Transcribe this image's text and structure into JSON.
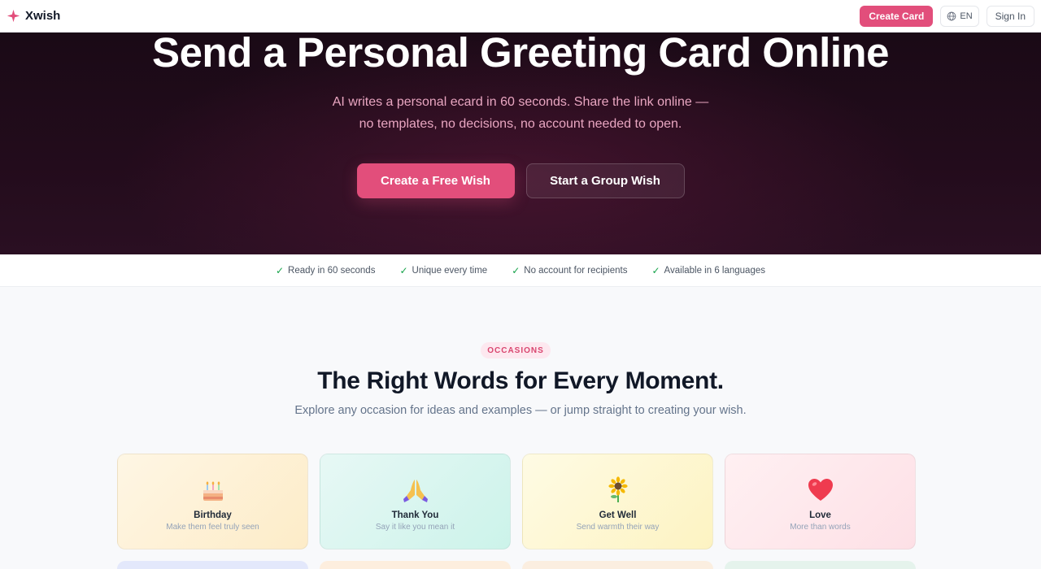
{
  "header": {
    "brand": "Xwish",
    "create_card": "Create Card",
    "language": "EN",
    "sign_in": "Sign In"
  },
  "hero": {
    "title": "Send a Personal Greeting Card Online",
    "subtitle_line1": "AI writes a personal ecard in 60 seconds. Share the link online —",
    "subtitle_line2": "no templates, no decisions, no account needed to open.",
    "primary_cta": "Create a Free Wish",
    "secondary_cta": "Start a Group Wish"
  },
  "features": [
    "Ready in 60 seconds",
    "Unique every time",
    "No account for recipients",
    "Available in 6 languages"
  ],
  "occasions": {
    "tag": "OCCASIONS",
    "title": "The Right Words for Every Moment.",
    "subtitle": "Explore any occasion for ideas and examples — or jump straight to creating your wish.",
    "cards": [
      {
        "title": "Birthday",
        "subtitle": "Make them feel truly seen",
        "icon": "birthday-cake-icon"
      },
      {
        "title": "Thank You",
        "subtitle": "Say it like you mean it",
        "icon": "praying-hands-icon"
      },
      {
        "title": "Get Well",
        "subtitle": "Send warmth their way",
        "icon": "sunflower-icon"
      },
      {
        "title": "Love",
        "subtitle": "More than words",
        "icon": "heart-icon"
      }
    ]
  },
  "colors": {
    "accent": "#e24e7b",
    "hero_bg": "#1f0b19",
    "check": "#16a34a"
  }
}
